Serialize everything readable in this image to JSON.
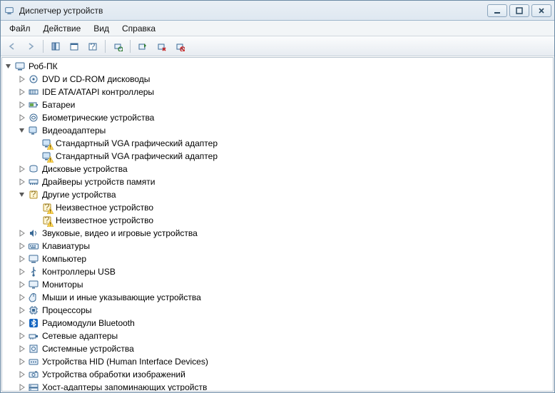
{
  "window": {
    "title": "Диспетчер устройств"
  },
  "menu": {
    "file": "Файл",
    "action": "Действие",
    "view": "Вид",
    "help": "Справка"
  },
  "tree": {
    "root": {
      "label": "Роб-ПК",
      "icon": "computer-icon",
      "expanded": true
    },
    "items": [
      {
        "label": "DVD и CD-ROM дисководы",
        "icon": "optical-drive-icon"
      },
      {
        "label": "IDE ATA/ATAPI контроллеры",
        "icon": "ide-controller-icon"
      },
      {
        "label": "Батареи",
        "icon": "battery-icon"
      },
      {
        "label": "Биометрические устройства",
        "icon": "biometric-icon"
      },
      {
        "label": "Видеоадаптеры",
        "icon": "display-adapter-icon",
        "expanded": true,
        "children": [
          {
            "label": "Стандартный VGA графический адаптер",
            "icon": "display-adapter-icon",
            "warning": true
          },
          {
            "label": "Стандартный VGA графический адаптер",
            "icon": "display-adapter-icon",
            "warning": true
          }
        ]
      },
      {
        "label": "Дисковые устройства",
        "icon": "disk-drive-icon"
      },
      {
        "label": "Драйверы устройств памяти",
        "icon": "memory-driver-icon"
      },
      {
        "label": "Другие устройства",
        "icon": "unknown-device-icon",
        "expanded": true,
        "children": [
          {
            "label": "Неизвестное устройство",
            "icon": "unknown-device-icon",
            "warning": true
          },
          {
            "label": "Неизвестное устройство",
            "icon": "unknown-device-icon",
            "warning": true
          }
        ]
      },
      {
        "label": "Звуковые, видео и игровые устройства",
        "icon": "sound-icon"
      },
      {
        "label": "Клавиатуры",
        "icon": "keyboard-icon"
      },
      {
        "label": "Компьютер",
        "icon": "computer-icon"
      },
      {
        "label": "Контроллеры USB",
        "icon": "usb-icon"
      },
      {
        "label": "Мониторы",
        "icon": "monitor-icon"
      },
      {
        "label": "Мыши и иные указывающие устройства",
        "icon": "mouse-icon"
      },
      {
        "label": "Процессоры",
        "icon": "cpu-icon"
      },
      {
        "label": "Радиомодули Bluetooth",
        "icon": "bluetooth-icon"
      },
      {
        "label": "Сетевые адаптеры",
        "icon": "network-adapter-icon"
      },
      {
        "label": "Системные устройства",
        "icon": "system-device-icon"
      },
      {
        "label": "Устройства HID (Human Interface Devices)",
        "icon": "hid-icon"
      },
      {
        "label": "Устройства обработки изображений",
        "icon": "imaging-icon"
      },
      {
        "label": "Хост-адаптеры запоминающих устройств",
        "icon": "storage-host-icon"
      }
    ]
  }
}
